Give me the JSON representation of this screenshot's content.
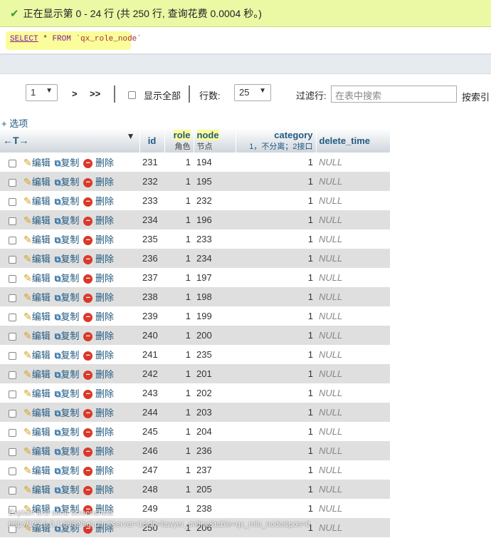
{
  "success": {
    "message": "正在显示第 0 - 24 行 (共 250 行, 查询花费 0.0004 秒。)"
  },
  "sql": {
    "select": "SELECT",
    "star": "*",
    "from": "FROM",
    "table": "`qx_role_node`"
  },
  "nav": {
    "page": "1",
    "next": ">",
    "last": ">>",
    "show_all": "显示全部",
    "rows_label": "行数:",
    "rows_value": "25",
    "filter_label": "过滤行:",
    "filter_placeholder": "在表中搜索",
    "sort_label": "按索引"
  },
  "options": "+ 选项",
  "columns": {
    "id": "id",
    "role": "role",
    "role_sub": "角色",
    "node": "node",
    "node_sub": "节点",
    "category": "category",
    "category_sub": "1，不分离；2接口",
    "delete_time": "delete_time"
  },
  "actions": {
    "edit": "编辑",
    "copy": "复制",
    "delete": "删除"
  },
  "rows": [
    {
      "id": "231",
      "role": "1",
      "node": "194",
      "category": "1",
      "delete_time": "NULL"
    },
    {
      "id": "232",
      "role": "1",
      "node": "195",
      "category": "1",
      "delete_time": "NULL"
    },
    {
      "id": "233",
      "role": "1",
      "node": "232",
      "category": "1",
      "delete_time": "NULL"
    },
    {
      "id": "234",
      "role": "1",
      "node": "196",
      "category": "1",
      "delete_time": "NULL"
    },
    {
      "id": "235",
      "role": "1",
      "node": "233",
      "category": "1",
      "delete_time": "NULL"
    },
    {
      "id": "236",
      "role": "1",
      "node": "234",
      "category": "1",
      "delete_time": "NULL"
    },
    {
      "id": "237",
      "role": "1",
      "node": "197",
      "category": "1",
      "delete_time": "NULL"
    },
    {
      "id": "238",
      "role": "1",
      "node": "198",
      "category": "1",
      "delete_time": "NULL"
    },
    {
      "id": "239",
      "role": "1",
      "node": "199",
      "category": "1",
      "delete_time": "NULL"
    },
    {
      "id": "240",
      "role": "1",
      "node": "200",
      "category": "1",
      "delete_time": "NULL"
    },
    {
      "id": "241",
      "role": "1",
      "node": "235",
      "category": "1",
      "delete_time": "NULL"
    },
    {
      "id": "242",
      "role": "1",
      "node": "201",
      "category": "1",
      "delete_time": "NULL"
    },
    {
      "id": "243",
      "role": "1",
      "node": "202",
      "category": "1",
      "delete_time": "NULL"
    },
    {
      "id": "244",
      "role": "1",
      "node": "203",
      "category": "1",
      "delete_time": "NULL"
    },
    {
      "id": "245",
      "role": "1",
      "node": "204",
      "category": "1",
      "delete_time": "NULL"
    },
    {
      "id": "246",
      "role": "1",
      "node": "236",
      "category": "1",
      "delete_time": "NULL"
    },
    {
      "id": "247",
      "role": "1",
      "node": "237",
      "category": "1",
      "delete_time": "NULL"
    },
    {
      "id": "248",
      "role": "1",
      "node": "205",
      "category": "1",
      "delete_time": "NULL"
    },
    {
      "id": "249",
      "role": "1",
      "node": "238",
      "category": "1",
      "delete_time": "NULL"
    },
    {
      "id": "250",
      "role": "1",
      "node": "206",
      "category": "1",
      "delete_time": "NULL"
    }
  ],
  "overlay": {
    "line1": "Explain and send screenshots",
    "line2": "http://127.0.0.1:8082/sql.php?server=1&db=lawyer_online&table=qx_role_node&pos=0"
  }
}
